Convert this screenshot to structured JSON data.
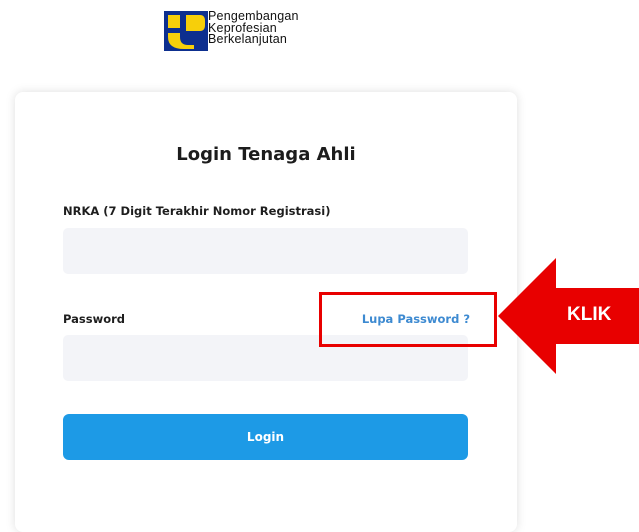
{
  "logo": {
    "lines": [
      "Pengembangan",
      "Keprofesian",
      "Berkelanjutan"
    ],
    "colors": {
      "blue": "#0d2f8f",
      "yellow": "#f7cf0a"
    }
  },
  "card": {
    "title": "Login Tenaga Ahli",
    "nrka_label": "NRKA (7 Digit Terakhir Nomor Registrasi)",
    "nrka_value": "",
    "password_label": "Password",
    "password_value": "",
    "forgot_link": "Lupa Password ?",
    "login_button": "Login"
  },
  "annotation": {
    "arrow_text": "KLIK",
    "color": "#e80000"
  },
  "colors": {
    "accent": "#1d9ae6",
    "link": "#3d8ad1",
    "field_bg": "#f3f4f8"
  }
}
